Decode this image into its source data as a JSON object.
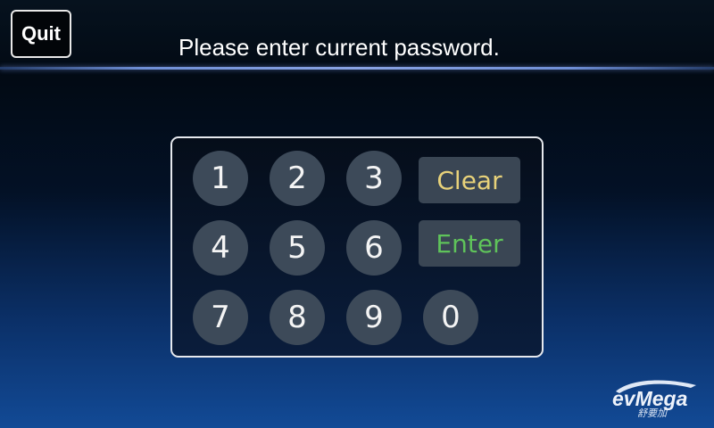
{
  "header": {
    "quit_label": "Quit",
    "title": "Please enter current password."
  },
  "keypad": {
    "keys": [
      "1",
      "2",
      "3",
      "4",
      "5",
      "6",
      "7",
      "8",
      "9",
      "0"
    ],
    "clear_label": "Clear",
    "enter_label": "Enter"
  },
  "colors": {
    "clear_text": "#e8d27a",
    "enter_text": "#5fc35a",
    "key_bg": "#3d4a59",
    "panel_border": "#e6e9ee"
  },
  "logo": {
    "text": "evMega",
    "subtext": "舒要加"
  }
}
